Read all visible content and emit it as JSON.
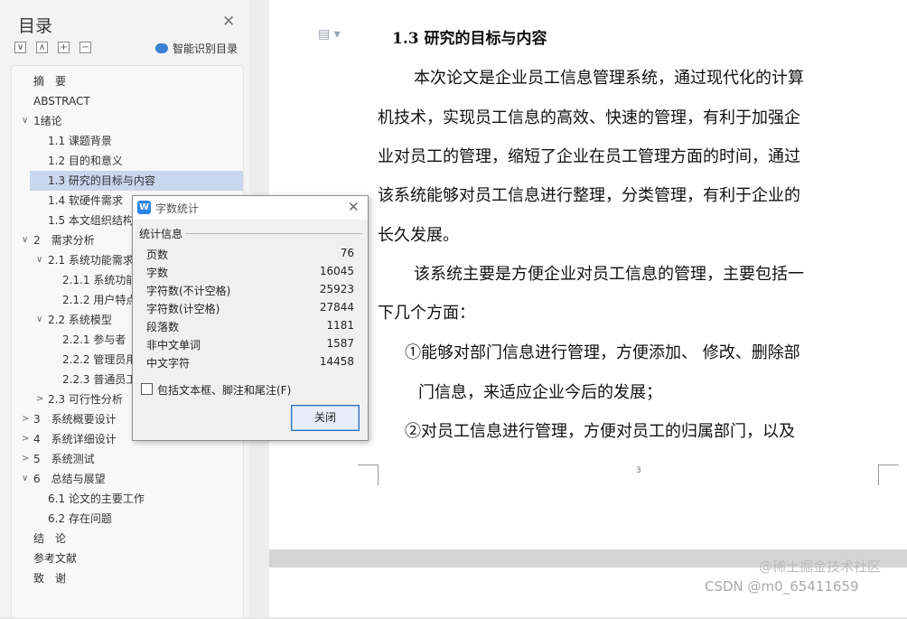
{
  "sidebar": {
    "title": "目录",
    "ai_button": "智能识别目录",
    "toolbar": [
      "∨",
      "∧",
      "+",
      "−"
    ],
    "items": [
      {
        "label": "摘　要",
        "level": 0,
        "arrow": ""
      },
      {
        "label": "ABSTRACT",
        "level": 0,
        "arrow": ""
      },
      {
        "label": "1绪论",
        "level": 0,
        "arrow": "∨"
      },
      {
        "label": "1.1 课题背景",
        "level": 1,
        "arrow": ""
      },
      {
        "label": "1.2 目的和意义",
        "level": 1,
        "arrow": ""
      },
      {
        "label": "1.3 研究的目标与内容",
        "level": 1,
        "arrow": "",
        "selected": true
      },
      {
        "label": "1.4 软硬件需求",
        "level": 1,
        "arrow": ""
      },
      {
        "label": "1.5 本文组织结构",
        "level": 1,
        "arrow": ""
      },
      {
        "label": "2　需求分析",
        "level": 0,
        "arrow": "∨"
      },
      {
        "label": "2.1 系统功能需求",
        "level": 1,
        "arrow": "∨"
      },
      {
        "label": "2.1.1 系统功能",
        "level": 2,
        "arrow": ""
      },
      {
        "label": "2.1.2 用户特点",
        "level": 2,
        "arrow": ""
      },
      {
        "label": "2.2 系统模型",
        "level": 1,
        "arrow": "∨"
      },
      {
        "label": "2.2.1 参与者",
        "level": 2,
        "arrow": ""
      },
      {
        "label": "2.2.2 管理员用",
        "level": 2,
        "arrow": ""
      },
      {
        "label": "2.2.3 普通员工",
        "level": 2,
        "arrow": ""
      },
      {
        "label": "2.3 可行性分析",
        "level": 1,
        "arrow": ">"
      },
      {
        "label": "3　系统概要设计",
        "level": 0,
        "arrow": ">"
      },
      {
        "label": "4　系统详细设计",
        "level": 0,
        "arrow": ">"
      },
      {
        "label": "5　系统测试",
        "level": 0,
        "arrow": ">"
      },
      {
        "label": "6　总结与展望",
        "level": 0,
        "arrow": "∨"
      },
      {
        "label": "6.1 论文的主要工作",
        "level": 1,
        "arrow": ""
      },
      {
        "label": "6.2 存在问题",
        "level": 1,
        "arrow": ""
      },
      {
        "label": "结　论",
        "level": 0,
        "arrow": ""
      },
      {
        "label": "参考文献",
        "level": 0,
        "arrow": ""
      },
      {
        "label": "致　谢",
        "level": 0,
        "arrow": ""
      }
    ]
  },
  "document": {
    "heading": "1.3 研究的目标与内容",
    "lines": [
      "本次论文是企业员工信息管理系统，通过现代化的计算",
      "机技术，实现员工信息的高效、快速的管理，有利于加强企",
      "业对员工的管理，缩短了企业在员工管理方面的时间，通过",
      "该系统能够对员工信息进行整理，分类管理，有利于企业的",
      "长久发展。",
      "该系统主要是方便企业对员工信息的管理，主要包括一",
      "下几个方面：",
      "①能够对部门信息进行管理，方便添加、 修改、删除部",
      "门信息，来适应企业今后的发展；",
      "②对员工信息进行管理，方便对员工的归属部门，以及"
    ],
    "page_number": "3"
  },
  "dialog": {
    "title": "字数统计",
    "group_label": "统计信息",
    "stats": [
      {
        "label": "页数",
        "value": "76"
      },
      {
        "label": "字数",
        "value": "16045"
      },
      {
        "label": "字符数(不计空格)",
        "value": "25923"
      },
      {
        "label": "字符数(计空格)",
        "value": "27844"
      },
      {
        "label": "段落数",
        "value": "1181"
      },
      {
        "label": "非中文单词",
        "value": "1587"
      },
      {
        "label": "中文字符",
        "value": "14458"
      }
    ],
    "checkbox_label": "包括文本框、脚注和尾注(F)",
    "close_button": "关闭"
  },
  "watermark": "CSDN @m0_65411659",
  "watermark2": "@稀土掘金技术社区"
}
